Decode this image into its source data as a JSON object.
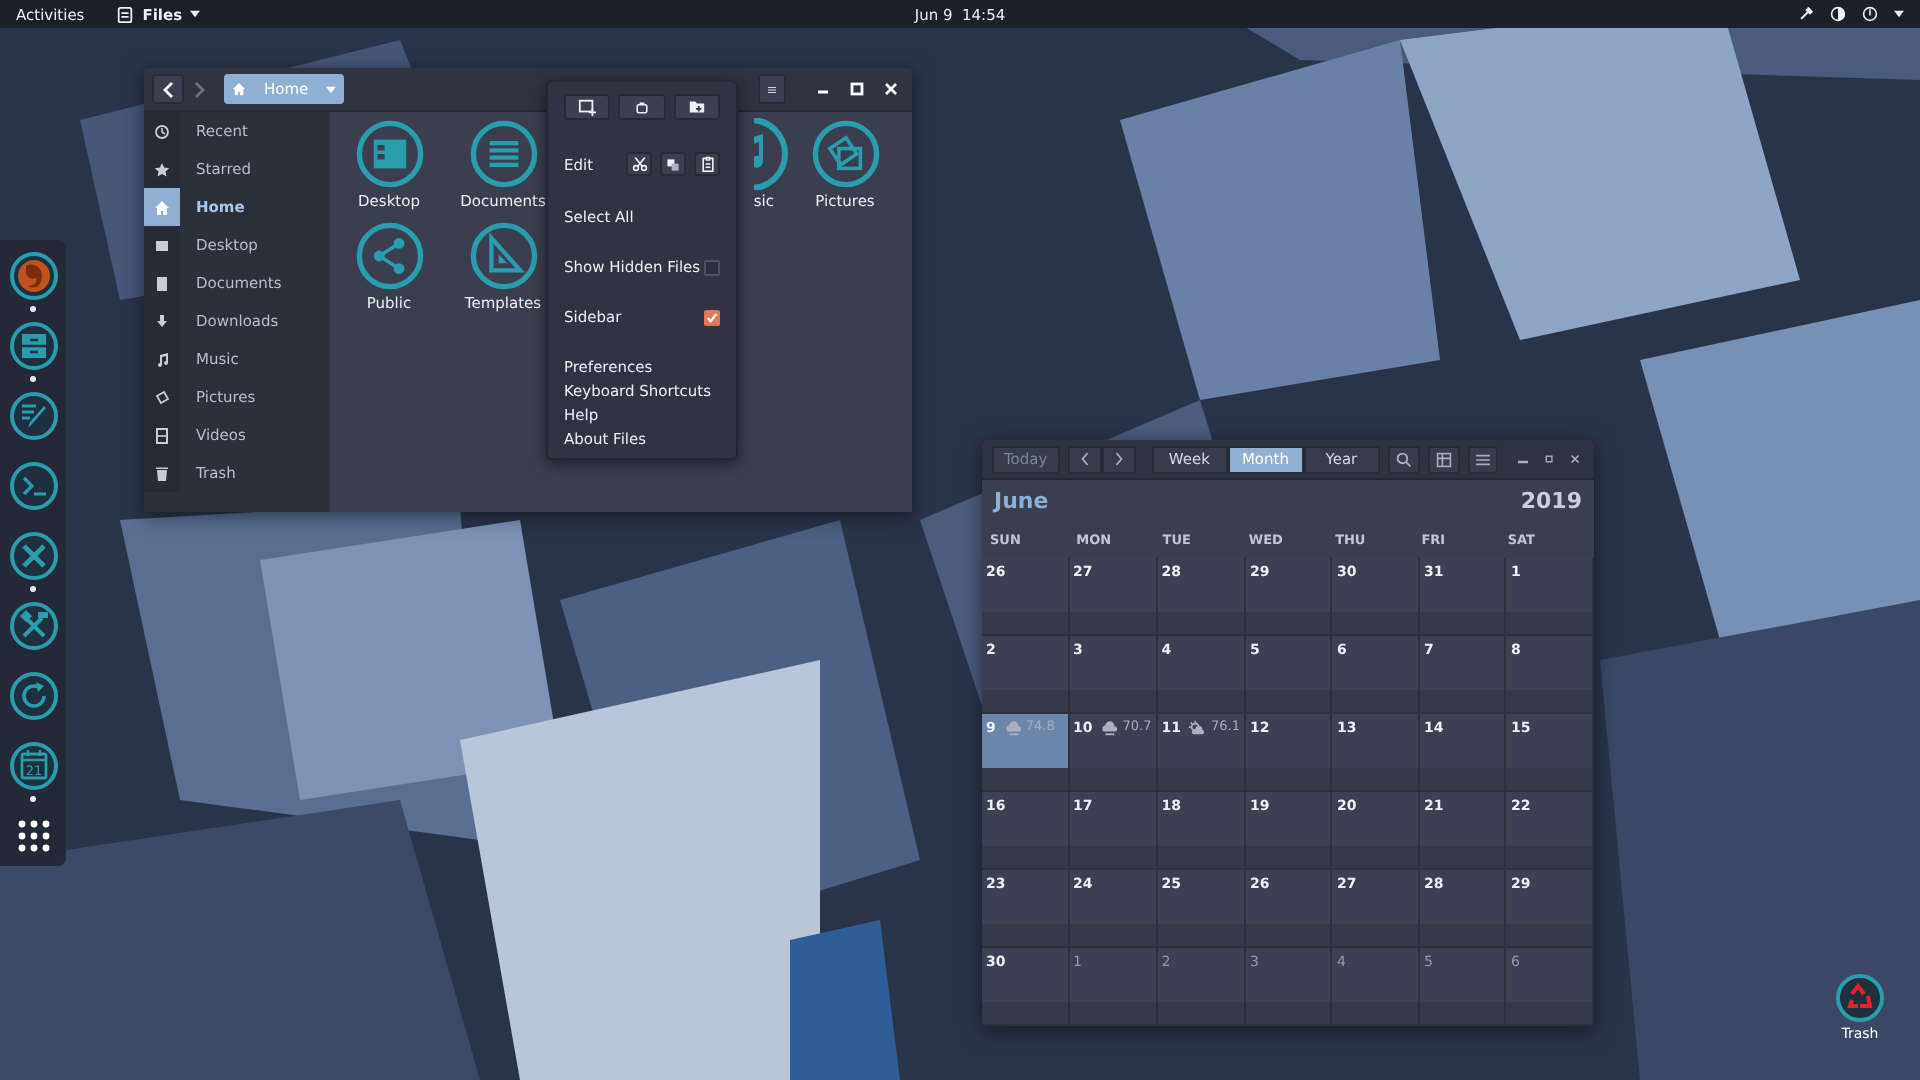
{
  "top_bar": {
    "activities": "Activities",
    "app_menu": "Files",
    "clock": "Jun 9  14:54"
  },
  "dock": {
    "items": [
      {
        "kind": "browser",
        "running": true
      },
      {
        "kind": "files",
        "running": true
      },
      {
        "kind": "editor",
        "running": false
      },
      {
        "kind": "terminal",
        "running": false
      },
      {
        "kind": "tools",
        "running": true
      },
      {
        "kind": "build",
        "running": false
      },
      {
        "kind": "update",
        "running": false
      },
      {
        "kind": "calendar",
        "running": true,
        "text": "21"
      },
      {
        "kind": "apps",
        "running": false
      }
    ]
  },
  "files_window": {
    "path": "Home",
    "sidebar": [
      {
        "kind": "recent",
        "label": "Recent",
        "selected": false
      },
      {
        "kind": "starred",
        "label": "Starred",
        "selected": false
      },
      {
        "kind": "home",
        "label": "Home",
        "selected": true
      },
      {
        "kind": "desktop",
        "label": "Desktop",
        "selected": false
      },
      {
        "kind": "documents",
        "label": "Documents",
        "selected": false
      },
      {
        "kind": "downloads",
        "label": "Downloads",
        "selected": false
      },
      {
        "kind": "music",
        "label": "Music",
        "selected": false
      },
      {
        "kind": "pictures",
        "label": "Pictures",
        "selected": false
      },
      {
        "kind": "videos",
        "label": "Videos",
        "selected": false
      },
      {
        "kind": "trash",
        "label": "Trash",
        "selected": false
      }
    ],
    "folders": [
      {
        "kind": "desktop",
        "label": "Desktop"
      },
      {
        "kind": "documents",
        "label": "Documents"
      },
      {
        "kind": "music",
        "label": "sic"
      },
      {
        "kind": "pictures",
        "label": "Pictures"
      },
      {
        "kind": "public",
        "label": "Public"
      },
      {
        "kind": "templates",
        "label": "Templates"
      }
    ]
  },
  "menu": {
    "edit_label": "Edit",
    "select_all": "Select All",
    "toggles": [
      {
        "label": "Show Hidden Files",
        "checked": false
      },
      {
        "label": "Sidebar",
        "checked": true
      }
    ],
    "items": [
      "Preferences",
      "Keyboard Shortcuts",
      "Help",
      "About Files"
    ]
  },
  "calendar": {
    "today": {
      "label": "Today",
      "disabled": true
    },
    "views": [
      {
        "label": "Week",
        "selected": false
      },
      {
        "label": "Month",
        "selected": true
      },
      {
        "label": "Year",
        "selected": false
      }
    ],
    "month": "June",
    "year": "2019",
    "weekdays": [
      "SUN",
      "MON",
      "TUE",
      "WED",
      "THU",
      "FRI",
      "SAT"
    ],
    "weeks": [
      [
        {
          "day": "26",
          "selected": false,
          "muted": false
        },
        {
          "day": "27",
          "selected": false,
          "muted": false
        },
        {
          "day": "28",
          "selected": false,
          "muted": false
        },
        {
          "day": "29",
          "selected": false,
          "muted": false
        },
        {
          "day": "30",
          "selected": false,
          "muted": false
        },
        {
          "day": "31",
          "selected": false,
          "muted": false
        },
        {
          "day": "1",
          "selected": false,
          "muted": false
        }
      ],
      [
        {
          "day": "2",
          "selected": false,
          "muted": false
        },
        {
          "day": "3",
          "selected": false,
          "muted": false
        },
        {
          "day": "4",
          "selected": false,
          "muted": false
        },
        {
          "day": "5",
          "selected": false,
          "muted": false
        },
        {
          "day": "6",
          "selected": false,
          "muted": false
        },
        {
          "day": "7",
          "selected": false,
          "muted": false
        },
        {
          "day": "8",
          "selected": false,
          "muted": false
        }
      ],
      [
        {
          "day": "9",
          "selected": true,
          "muted": false,
          "weather": {
            "kind": "rain",
            "temp": "74.8"
          }
        },
        {
          "day": "10",
          "selected": false,
          "muted": false,
          "weather": {
            "kind": "rain",
            "temp": "70.7"
          }
        },
        {
          "day": "11",
          "selected": false,
          "muted": false,
          "weather": {
            "kind": "sun-cloud",
            "temp": "76.1"
          }
        },
        {
          "day": "12",
          "selected": false,
          "muted": false
        },
        {
          "day": "13",
          "selected": false,
          "muted": false
        },
        {
          "day": "14",
          "selected": false,
          "muted": false
        },
        {
          "day": "15",
          "selected": false,
          "muted": false
        }
      ],
      [
        {
          "day": "16",
          "selected": false,
          "muted": false
        },
        {
          "day": "17",
          "selected": false,
          "muted": false
        },
        {
          "day": "18",
          "selected": false,
          "muted": false
        },
        {
          "day": "19",
          "selected": false,
          "muted": false
        },
        {
          "day": "20",
          "selected": false,
          "muted": false
        },
        {
          "day": "21",
          "selected": false,
          "muted": false
        },
        {
          "day": "22",
          "selected": false,
          "muted": false
        }
      ],
      [
        {
          "day": "23",
          "selected": false,
          "muted": false
        },
        {
          "day": "24",
          "selected": false,
          "muted": false
        },
        {
          "day": "25",
          "selected": false,
          "muted": false
        },
        {
          "day": "26",
          "selected": false,
          "muted": false
        },
        {
          "day": "27",
          "selected": false,
          "muted": false
        },
        {
          "day": "28",
          "selected": false,
          "muted": false
        },
        {
          "day": "29",
          "selected": false,
          "muted": false
        }
      ],
      [
        {
          "day": "30",
          "selected": false,
          "muted": false
        },
        {
          "day": "1",
          "selected": false,
          "muted": true
        },
        {
          "day": "2",
          "selected": false,
          "muted": true
        },
        {
          "day": "3",
          "selected": false,
          "muted": true
        },
        {
          "day": "4",
          "selected": false,
          "muted": true
        },
        {
          "day": "5",
          "selected": false,
          "muted": true
        },
        {
          "day": "6",
          "selected": false,
          "muted": true
        }
      ]
    ]
  },
  "desktop_icons": [
    {
      "label": "Trash"
    }
  ]
}
